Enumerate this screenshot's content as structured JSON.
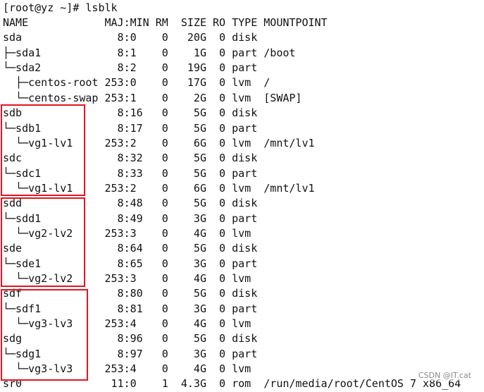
{
  "terminal": {
    "prompt": "[root@yz ~]# lsblk",
    "lines": [
      "NAME            MAJ:MIN RM  SIZE RO TYPE MOUNTPOINT",
      "sda               8:0    0   20G  0 disk",
      "├─sda1            8:1    0    1G  0 part /boot",
      "└─sda2            8:2    0   19G  0 part",
      "  ├─centos-root 253:0    0   17G  0 lvm  /",
      "  └─centos-swap 253:1    0    2G  0 lvm  [SWAP]",
      "sdb               8:16   0    5G  0 disk",
      "└─sdb1            8:17   0    5G  0 part",
      "  └─vg1-lv1     253:2    0    6G  0 lvm  /mnt/lv1",
      "sdc               8:32   0    5G  0 disk",
      "└─sdc1            8:33   0    5G  0 part",
      "  └─vg1-lv1     253:2    0    6G  0 lvm  /mnt/lv1",
      "sdd               8:48   0    5G  0 disk",
      "└─sdd1            8:49   0    3G  0 part",
      "  └─vg2-lv2     253:3    0    4G  0 lvm",
      "sde               8:64   0    5G  0 disk",
      "└─sde1            8:65   0    3G  0 part",
      "  └─vg2-lv2     253:3    0    4G  0 lvm",
      "sdf               8:80   0    5G  0 disk",
      "└─sdf1            8:81   0    3G  0 part",
      "  └─vg3-lv3     253:4    0    4G  0 lvm",
      "sdg               8:96   0    5G  0 disk",
      "└─sdg1            8:97   0    3G  0 part",
      "  └─vg3-lv3     253:4    0    4G  0 lvm",
      "sr0              11:0    1  4.3G  0 rom  /run/media/root/CentOS 7 x86_64"
    ]
  },
  "watermark": "CSDN @IT.cat",
  "colors": {
    "background": "#ffffff",
    "text": "#111111",
    "highlight_border": "#e5141f"
  }
}
